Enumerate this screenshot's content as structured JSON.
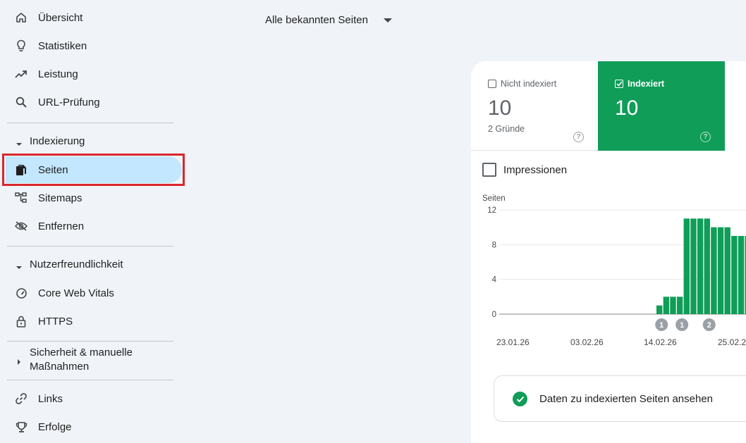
{
  "sidebar": {
    "items": [
      {
        "label": "Übersicht",
        "icon": "home-icon"
      },
      {
        "label": "Statistiken",
        "icon": "lightbulb-icon"
      },
      {
        "label": "Leistung",
        "icon": "trending-up-icon"
      },
      {
        "label": "URL-Prüfung",
        "icon": "search-icon"
      }
    ],
    "sections": {
      "indexierung": "Indexierung",
      "nutzer": "Nutzerfreundlichkeit",
      "sicherheit": "Sicherheit & manuelle Maßnahmen"
    },
    "indexierung_items": [
      {
        "label": "Seiten",
        "icon": "pages-icon",
        "active": true
      },
      {
        "label": "Sitemaps",
        "icon": "sitemap-icon"
      },
      {
        "label": "Entfernen",
        "icon": "visibility-off-icon"
      }
    ],
    "nutzer_items": [
      {
        "label": "Core Web Vitals",
        "icon": "speedometer-icon"
      },
      {
        "label": "HTTPS",
        "icon": "lock-icon"
      }
    ],
    "bottom_items": [
      {
        "label": "Links",
        "icon": "link-icon"
      },
      {
        "label": "Erfolge",
        "icon": "trophy-icon"
      }
    ]
  },
  "page_filter": {
    "label": "Alle bekannten Seiten"
  },
  "tiles": {
    "not_indexed": {
      "label": "Nicht indexiert",
      "value": "10",
      "sub": "2 Gründe",
      "checked": false
    },
    "indexed": {
      "label": "Indexiert",
      "value": "10",
      "checked": true
    }
  },
  "impressions": {
    "label": "Impressionen",
    "checked": false
  },
  "colors": {
    "accent_green": "#0f9d58",
    "active_nav": "#c2e7ff",
    "highlight_red": "#d9262c"
  },
  "chart_data": {
    "type": "bar",
    "ylabel": "Seiten",
    "ylim": [
      0,
      12
    ],
    "yticks": [
      "0",
      "4",
      "8",
      "12"
    ],
    "xticks": [
      "23.01.26",
      "03.02.26",
      "14.02.26",
      "25.02.2"
    ],
    "values": [
      0,
      0,
      0,
      0,
      0,
      0,
      0,
      0,
      0,
      0,
      0,
      0,
      0,
      0,
      0,
      0,
      0,
      0,
      0,
      0,
      0,
      0,
      1,
      2,
      2,
      2,
      11,
      11,
      11,
      11,
      10,
      10,
      10,
      9,
      9,
      9
    ],
    "annotations": [
      {
        "index": 22,
        "label": "1"
      },
      {
        "index": 25,
        "label": "1"
      },
      {
        "index": 29,
        "label": "2"
      }
    ]
  },
  "data_button": {
    "label": "Daten zu indexierten Seiten ansehen"
  }
}
